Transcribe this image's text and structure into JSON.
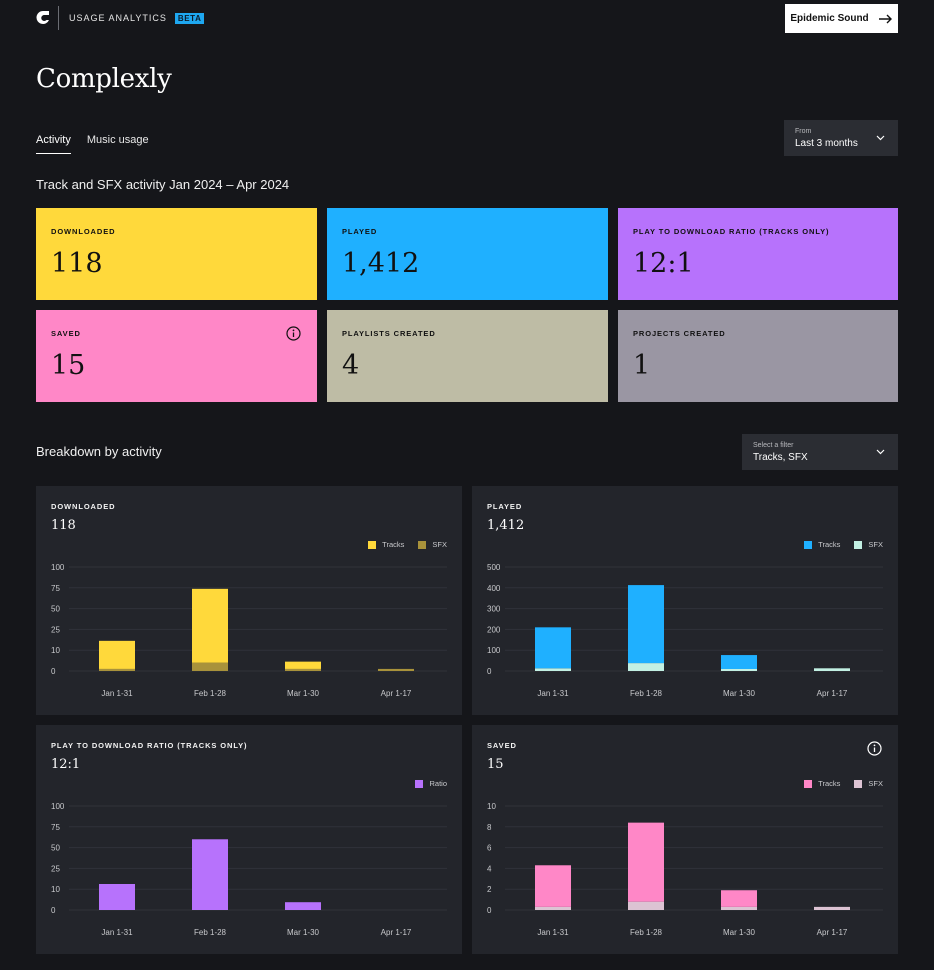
{
  "header": {
    "app_name": "USAGE ANALYTICS",
    "badge": "BETA",
    "account_button": "Epidemic Sound",
    "colors": {
      "badge": "#1ea7f0"
    }
  },
  "page_title": "Complexly",
  "tabs": [
    {
      "label": "Activity",
      "active": true
    },
    {
      "label": "Music usage",
      "active": false
    }
  ],
  "date_filter": {
    "label": "From",
    "value": "Last 3 months"
  },
  "summary": {
    "heading": "Track and SFX activity Jan 2024 – Apr 2024",
    "cards": [
      {
        "label": "DOWNLOADED",
        "value": "118",
        "color": "#ffd93b"
      },
      {
        "label": "PLAYED",
        "value": "1,412",
        "color": "#1fb0ff"
      },
      {
        "label": "PLAY TO DOWNLOAD RATIO (TRACKS ONLY)",
        "value": "12:1",
        "color": "#b772fc"
      },
      {
        "label": "SAVED",
        "value": "15",
        "color": "#ff87c7",
        "icon": "info-icon"
      },
      {
        "label": "PLAYLISTS CREATED",
        "value": "4",
        "color": "#bebca5"
      },
      {
        "label": "PROJECTS CREATED",
        "value": "1",
        "color": "#9a96a3"
      }
    ]
  },
  "breakdown": {
    "heading": "Breakdown by activity",
    "filter": {
      "label": "Select a filter",
      "value": "Tracks, SFX"
    }
  },
  "chart_data": [
    {
      "type": "bar",
      "title": "DOWNLOADED",
      "total": "118",
      "categories": [
        "Jan 1-31",
        "Feb 1-28",
        "Mar 1-30",
        "Apr 1-17"
      ],
      "yticks": [
        "100",
        "75",
        "50",
        "25",
        "10",
        "0"
      ],
      "series": [
        {
          "name": "Tracks",
          "color": "#ffd93b",
          "values": [
            27,
            71,
            7,
            0
          ]
        },
        {
          "name": "SFX",
          "color": "#a8923b",
          "values": [
            2,
            8,
            2,
            2
          ]
        }
      ]
    },
    {
      "type": "bar",
      "title": "PLAYED",
      "total": "1,412",
      "categories": [
        "Jan 1-31",
        "Feb 1-28",
        "Mar 1-30",
        "Apr 1-17"
      ],
      "yticks": [
        "500",
        "400",
        "300",
        "200",
        "100",
        "0"
      ],
      "series": [
        {
          "name": "Tracks",
          "color": "#1fb0ff",
          "values": [
            197,
            375,
            67,
            0
          ]
        },
        {
          "name": "SFX",
          "color": "#c2f0e3",
          "values": [
            13,
            38,
            9,
            13
          ]
        }
      ]
    },
    {
      "type": "bar",
      "title": "PLAY TO DOWNLOAD RATIO (TRACKS ONLY)",
      "total": "12:1",
      "categories": [
        "Jan 1-31",
        "Feb 1-28",
        "Mar 1-30",
        "Apr 1-17"
      ],
      "yticks": [
        "100",
        "75",
        "50",
        "25",
        "10",
        "0"
      ],
      "series": [
        {
          "name": "Ratio",
          "color": "#b772fc",
          "values": [
            25,
            68,
            7.5,
            0
          ]
        }
      ]
    },
    {
      "type": "bar",
      "title": "SAVED",
      "total": "15",
      "categories": [
        "Jan 1-31",
        "Feb 1-28",
        "Mar 1-30",
        "Apr 1-17"
      ],
      "yticks": [
        "10",
        "8",
        "6",
        "4",
        "2",
        "0"
      ],
      "series": [
        {
          "name": "Tracks",
          "color": "#ff87c7",
          "values": [
            4,
            7.6,
            1.6,
            0
          ]
        },
        {
          "name": "SFX",
          "color": "#dcc3d3",
          "values": [
            0.3,
            0.8,
            0.3,
            0.3
          ]
        }
      ]
    }
  ]
}
